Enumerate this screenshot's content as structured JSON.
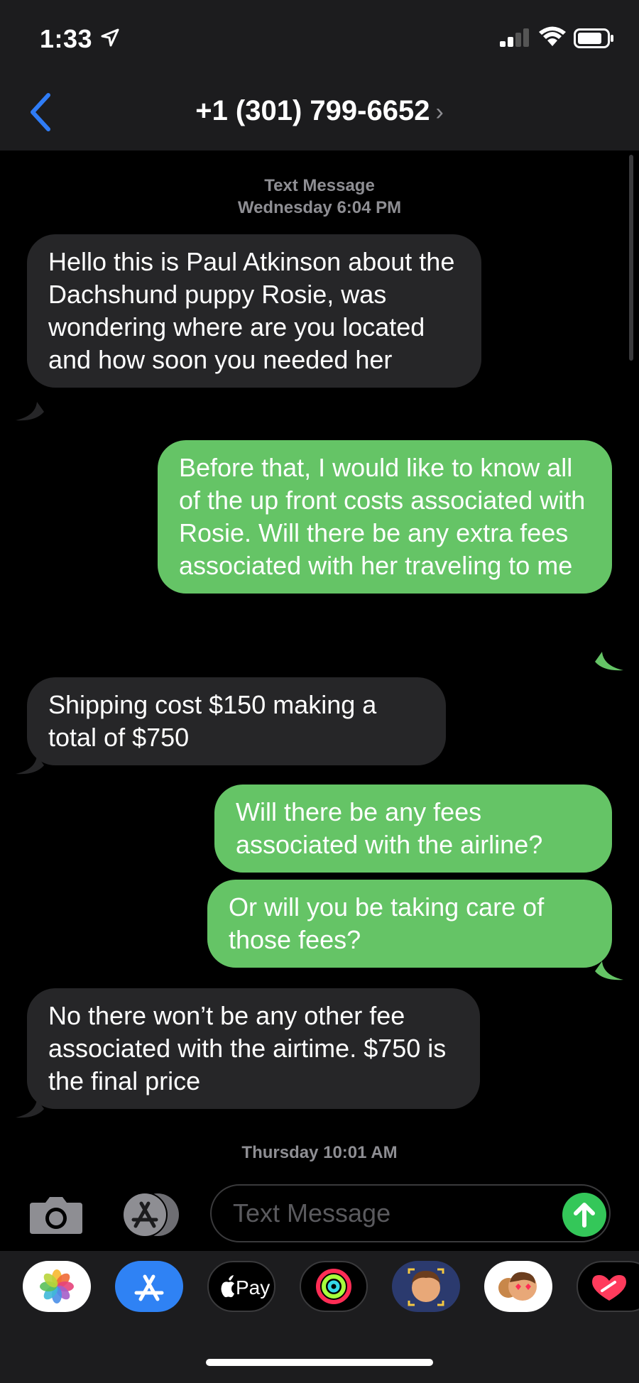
{
  "status": {
    "time": "1:33"
  },
  "nav": {
    "contact": "+1 (301) 799-6652",
    "chevron": "›"
  },
  "thread": {
    "header_label": "Text Message",
    "header_time": "Wednesday 6:04 PM",
    "messages": [
      {
        "side": "incoming",
        "text": "Hello this is Paul Atkinson about the Dachshund puppy Rosie, was wondering where are you located and how soon you needed her"
      },
      {
        "side": "outgoing",
        "text": "Before that, I would like to know all of the up front costs associated with Rosie. Will there be any extra fees associated with her traveling to me"
      },
      {
        "side": "incoming",
        "text": "Shipping cost $150 making a total of $750"
      },
      {
        "side": "outgoing",
        "text": "Will there be any fees associated with the airline?"
      },
      {
        "side": "outgoing",
        "text": "Or will you be taking care of those fees?"
      },
      {
        "side": "incoming",
        "text": "No there won’t be any other fee associated with the airtime. $750 is the final price"
      }
    ],
    "footer_time": "Thursday 10:01 AM"
  },
  "composer": {
    "placeholder": "Text Message"
  },
  "apps": [
    "photos-icon",
    "app-store-icon",
    "apple-pay-icon",
    "activity-icon",
    "memoji-icon",
    "animoji-icon",
    "digital-touch-icon"
  ],
  "applepay_label": "Pay",
  "colors": {
    "outgoing": "#65c466",
    "incoming": "#262628",
    "accent": "#2f7cf6",
    "send": "#34c759"
  }
}
